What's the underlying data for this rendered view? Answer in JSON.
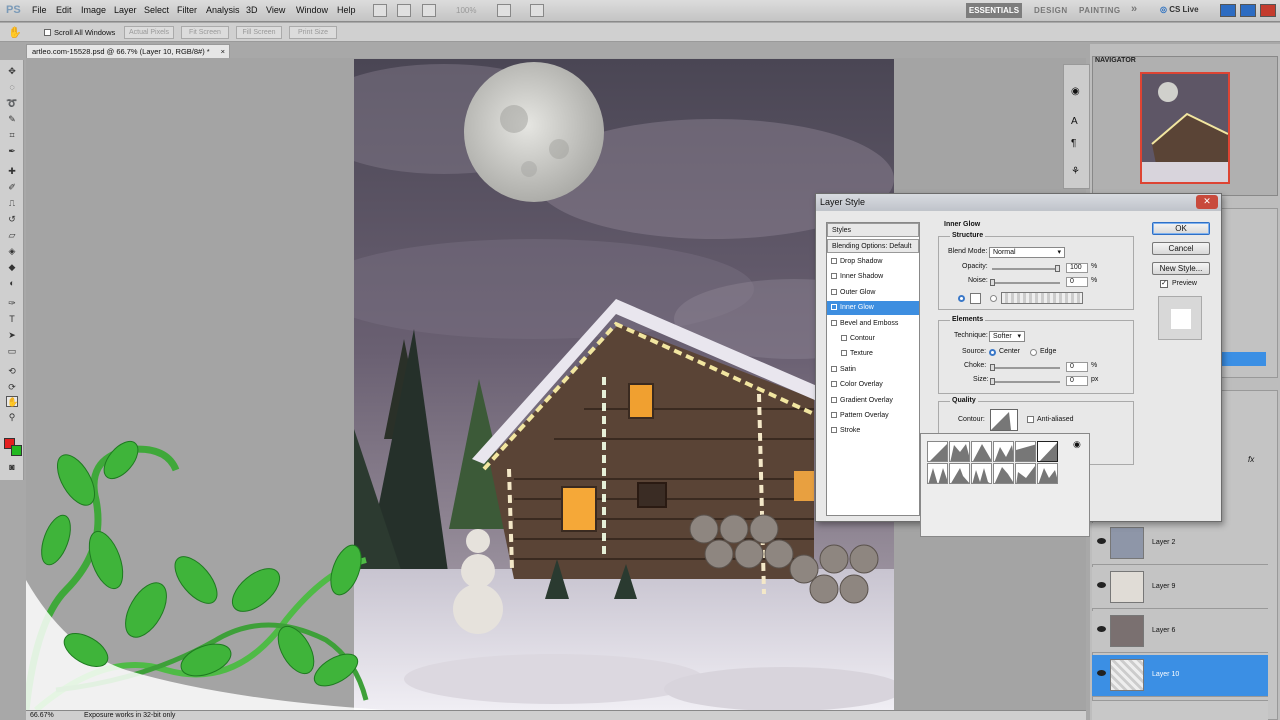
{
  "app": {
    "logo": "PS"
  },
  "menu": {
    "items": [
      "File",
      "Edit",
      "Image",
      "Layer",
      "Select",
      "Filter",
      "Analysis",
      "3D",
      "View",
      "Window",
      "Help"
    ]
  },
  "toolbar": {
    "zoom_value": "100%"
  },
  "workspace": {
    "essentials": "ESSENTIALS",
    "design": "DESIGN",
    "painting": "PAINTING",
    "more": "»",
    "cslive": "CS Live"
  },
  "options": {
    "scroll_all": "Scroll All Windows",
    "actual_pixels": "Actual Pixels",
    "fit_screen": "Fit Screen",
    "fill_screen": "Fill Screen",
    "print_size": "Print Size"
  },
  "document": {
    "tab_title": "artleo.com-15528.psd @ 66.7% (Layer 10, RGB/8#) *",
    "close": "×"
  },
  "status": {
    "zoom": "66.67%",
    "message": "Exposure works in 32-bit only"
  },
  "navigator": {
    "title": "NAVIGATOR"
  },
  "layers": [
    {
      "name": "Layer 2"
    },
    {
      "name": "Layer 9"
    },
    {
      "name": "Layer 6"
    },
    {
      "name": "Layer 10",
      "selected": true
    }
  ],
  "layers_panel": {
    "fx": "fx"
  },
  "dialog": {
    "title": "Layer Style",
    "close": "✕",
    "styles_header": "Styles",
    "blending_options": "Blending Options: Default",
    "items": [
      {
        "label": "Drop Shadow",
        "checked": false
      },
      {
        "label": "Inner Shadow",
        "checked": false
      },
      {
        "label": "Outer Glow",
        "checked": false
      },
      {
        "label": "Inner Glow",
        "checked": true,
        "selected": true
      },
      {
        "label": "Bevel and Emboss",
        "checked": false
      },
      {
        "label": "Contour",
        "checked": false,
        "indent": true
      },
      {
        "label": "Texture",
        "checked": false,
        "indent": true
      },
      {
        "label": "Satin",
        "checked": false
      },
      {
        "label": "Color Overlay",
        "checked": false
      },
      {
        "label": "Gradient Overlay",
        "checked": false
      },
      {
        "label": "Pattern Overlay",
        "checked": false
      },
      {
        "label": "Stroke",
        "checked": false
      }
    ],
    "section_title": "Inner Glow",
    "structure": {
      "title": "Structure",
      "blend_mode_label": "Blend Mode:",
      "blend_mode": "Normal",
      "opacity_label": "Opacity:",
      "opacity": "100",
      "noise_label": "Noise:",
      "noise": "0",
      "percent": "%"
    },
    "elements": {
      "title": "Elements",
      "technique_label": "Technique:",
      "technique": "Softer",
      "source_label": "Source:",
      "center": "Center",
      "edge": "Edge",
      "choke_label": "Choke:",
      "choke": "0",
      "size_label": "Size:",
      "size": "0",
      "px": "px",
      "percent": "%"
    },
    "quality": {
      "title": "Quality",
      "contour_label": "Contour:",
      "anti_aliased": "Anti-aliased"
    },
    "buttons": {
      "ok": "OK",
      "cancel": "Cancel",
      "new_style": "New Style...",
      "preview": "Preview"
    }
  }
}
